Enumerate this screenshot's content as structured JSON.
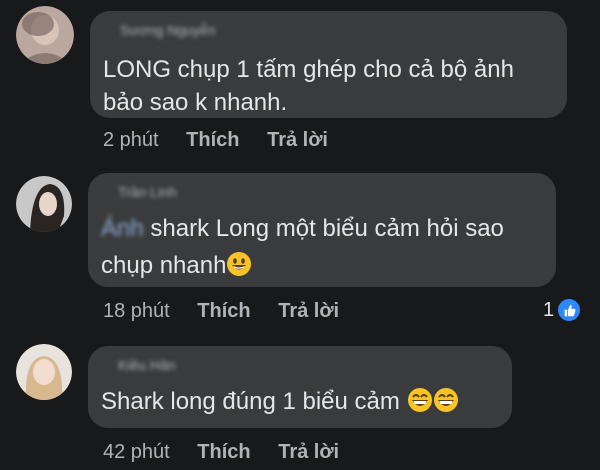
{
  "comments": [
    {
      "author": "Sương Nguyễn",
      "text_lines": [
        "LONG  chụp 1 tấm ghép cho cả bộ ảnh",
        "bảo sao k nhanh."
      ],
      "time": "2 phút",
      "like_label": "Thích",
      "reply_label": "Trả lời"
    },
    {
      "author": "Trần Linh",
      "mention": "Ánh",
      "text_line1": "shark Long một biểu cảm hỏi sao",
      "text_line2": "chụp nhanh",
      "emoji": "grinning-face",
      "time": "18 phút",
      "like_label": "Thích",
      "reply_label": "Trả lời",
      "reaction_count": "1",
      "reaction_icon": "like-icon"
    },
    {
      "author": "Kiều Hân",
      "text": "Shark long đúng 1 biểu cảm ",
      "emojis": [
        "beaming-face",
        "beaming-face"
      ],
      "time": "42 phút",
      "like_label": "Thích",
      "reply_label": "Trả lời"
    }
  ],
  "colors": {
    "background": "#18191a",
    "bubble": "#3a3b3c",
    "text": "#e4e6eb",
    "muted": "#b0b3b8",
    "like_blue": "#2d88ff"
  }
}
